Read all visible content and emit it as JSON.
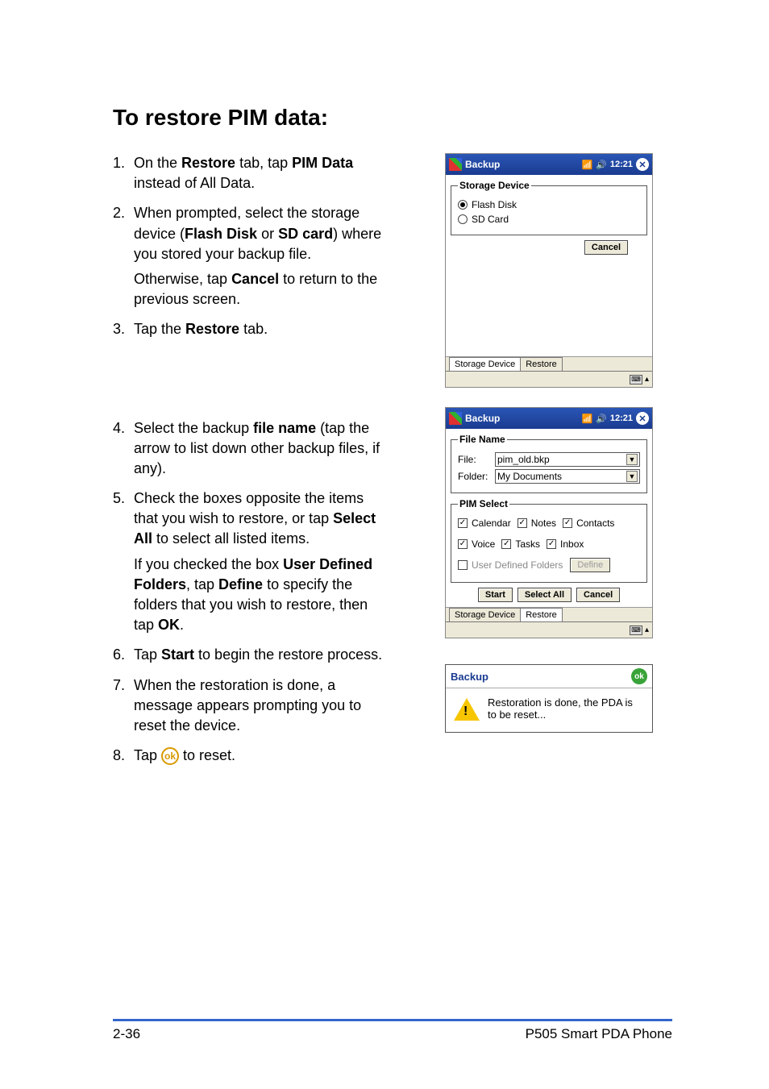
{
  "heading": "To restore PIM data:",
  "steps": [
    {
      "n": "1.",
      "parts": [
        {
          "t": "On the "
        },
        {
          "t": "Restore",
          "b": true
        },
        {
          "t": " tab, tap "
        },
        {
          "t": "PIM Data",
          "b": true
        },
        {
          "t": " instead of All Data."
        }
      ]
    },
    {
      "n": "2.",
      "parts": [
        {
          "t": "When prompted, select the storage device ("
        },
        {
          "t": "Flash Disk",
          "b": true
        },
        {
          "t": " or "
        },
        {
          "t": "SD card",
          "b": true
        },
        {
          "t": ") where you stored your backup file."
        }
      ],
      "subparts": [
        {
          "t": "Otherwise, tap "
        },
        {
          "t": "Cancel",
          "b": true
        },
        {
          "t": " to return to the previous screen."
        }
      ]
    },
    {
      "n": "3.",
      "parts": [
        {
          "t": "Tap the "
        },
        {
          "t": "Restore",
          "b": true
        },
        {
          "t": " tab."
        }
      ]
    },
    {
      "n": "4.",
      "parts": [
        {
          "t": "Select the backup "
        },
        {
          "t": "file name",
          "b": true
        },
        {
          "t": " (tap the arrow to list down other backup files, if any)."
        }
      ]
    },
    {
      "n": "5.",
      "parts": [
        {
          "t": "Check the boxes opposite the items that you wish to restore, or tap "
        },
        {
          "t": "Select All",
          "b": true
        },
        {
          "t": " to select all listed items."
        }
      ],
      "subparts": [
        {
          "t": "If you checked the box "
        },
        {
          "t": "User Defined Folders",
          "b": true
        },
        {
          "t": ", tap "
        },
        {
          "t": "Define",
          "b": true
        },
        {
          "t": " to specify the folders that you wish to restore, then tap "
        },
        {
          "t": "OK",
          "b": true
        },
        {
          "t": "."
        }
      ]
    },
    {
      "n": "6.",
      "parts": [
        {
          "t": "Tap "
        },
        {
          "t": "Start",
          "b": true
        },
        {
          "t": " to begin the restore process."
        }
      ]
    },
    {
      "n": "7.",
      "parts": [
        {
          "t": "When the restoration is done, a message appears prompting you to reset the device."
        }
      ]
    },
    {
      "n": "8.",
      "parts": [
        {
          "t": "Tap "
        },
        {
          "icon": "ok"
        },
        {
          "t": " to reset."
        }
      ]
    }
  ],
  "shot1": {
    "title": "Backup",
    "time": "12:21",
    "group": "Storage Device",
    "opt1": "Flash Disk",
    "opt2": "SD Card",
    "cancel": "Cancel",
    "tab1": "Storage Device",
    "tab2": "Restore"
  },
  "shot2": {
    "title": "Backup",
    "time": "12:21",
    "grp_file": "File Name",
    "lbl_file": "File:",
    "val_file": "pim_old.bkp",
    "lbl_folder": "Folder:",
    "val_folder": "My Documents",
    "grp_pim": "PIM Select",
    "c1": "Calendar",
    "c2": "Notes",
    "c3": "Contacts",
    "c4": "Voice",
    "c5": "Tasks",
    "c6": "Inbox",
    "udf": "User Defined Folders",
    "define": "Define",
    "start": "Start",
    "selall": "Select All",
    "cancel": "Cancel",
    "tab1": "Storage Device",
    "tab2": "Restore"
  },
  "dialog": {
    "title": "Backup",
    "ok": "ok",
    "msg": "Restoration is done, the PDA is to be reset..."
  },
  "footer": {
    "left": "2-36",
    "right": "P505 Smart PDA Phone"
  }
}
